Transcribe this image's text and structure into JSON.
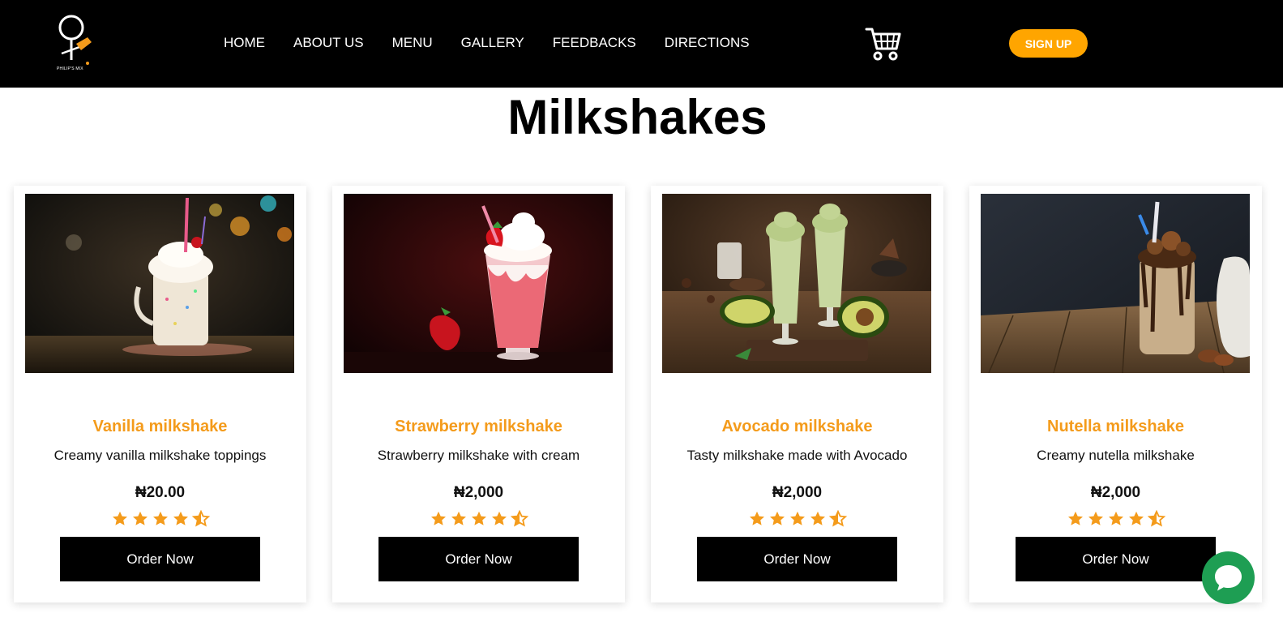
{
  "header": {
    "logo_text": "PHILIP'S MIX",
    "nav": [
      "HOME",
      "ABOUT US",
      "MENU",
      "GALLERY",
      "FEEDBACKS",
      "DIRECTIONS"
    ],
    "cart_icon": "shopping-cart-icon",
    "signup_label": "SIGN UP"
  },
  "section": {
    "title": "Milkshakes"
  },
  "products": [
    {
      "name": "Vanilla milkshake",
      "description": "Creamy vanilla milkshake toppings",
      "price": "₦20.00",
      "rating": 4.5,
      "order_label": "Order Now"
    },
    {
      "name": "Strawberry milkshake",
      "description": "Strawberry milkshake with cream",
      "price": "₦2,000",
      "rating": 4.5,
      "order_label": "Order Now"
    },
    {
      "name": "Avocado milkshake",
      "description": "Tasty milkshake made with Avocado",
      "price": "₦2,000",
      "rating": 4.5,
      "order_label": "Order Now"
    },
    {
      "name": "Nutella milkshake",
      "description": "Creamy nutella milkshake",
      "price": "₦2,000",
      "rating": 4.5,
      "order_label": "Order Now"
    }
  ],
  "chat": {
    "icon": "chat-bubble-icon"
  },
  "colors": {
    "navbar": "#000000",
    "accent": "#ffa500",
    "product_name": "#f49b1b",
    "chat": "#1e9e53"
  }
}
